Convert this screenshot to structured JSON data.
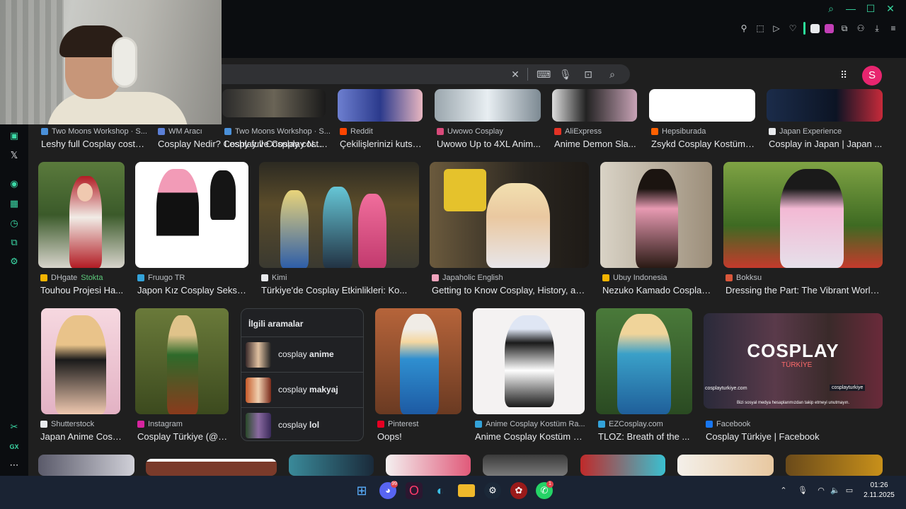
{
  "toolbar": {
    "icons": [
      "search-icon",
      "minimize-icon",
      "maximize-icon",
      "close-icon",
      "pin-icon",
      "screenshot-icon",
      "play-icon",
      "heart-icon",
      "extension-icon",
      "puzzle-icon",
      "account-icon",
      "download-icon",
      "menu-icon"
    ]
  },
  "search": {
    "avatar_letter": "S"
  },
  "rows": {
    "r1": [
      {
        "source": "Two Moons Workshop · S...",
        "title": "Leshy full Cosplay costu..."
      },
      {
        "source": "WM Aracı",
        "title": "Cosplay Nedir? Cosplay ve Cosplay Nası..."
      },
      {
        "source": "Reddit",
        "title": "Çekilişlerinizi kutsa..."
      },
      {
        "source": "Uwowo Cosplay",
        "title": "Uwowo Up to 4XL Anim..."
      },
      {
        "source": "AliExpress",
        "title": "Anime Demon Sla..."
      },
      {
        "source": "Hepsiburada",
        "title": "Zsykd Cosplay Kostüm ..."
      },
      {
        "source": "Japan Experience",
        "title": "Cosplay in Japan | Japan ..."
      }
    ],
    "r2": [
      {
        "source": "DHgate",
        "source_extra": "Stokta",
        "title": "Touhou Projesi Ha..."
      },
      {
        "source": "Fruugo TR",
        "title": "Japon Kız Cosplay Seksi ..."
      },
      {
        "source": "Kimi",
        "title": "Türkiye'de Cosplay Etkinlikleri: Ko..."
      },
      {
        "source": "Japaholic English",
        "title": "Getting to Know Cosplay, History, and ..."
      },
      {
        "source": "Ubuy Indonesia",
        "title": "Nezuko Kamado Cosplay ..."
      },
      {
        "source": "Bokksu",
        "title": "Dressing the Part: The Vibrant World ..."
      }
    ],
    "r3": [
      {
        "source": "Shutterstock",
        "title": "Japan Anime Cosp..."
      },
      {
        "source": "Instagram",
        "title": "Cosplay Türkiye (@c..."
      },
      {
        "source": "Pinterest",
        "title": "Oops!"
      },
      {
        "source": "Anime Cosplay Kostüm Ra...",
        "title": "Anime Cosplay Kostüm R..."
      },
      {
        "source": "EZCosplay.com",
        "title": "TLOZ: Breath of the ..."
      },
      {
        "source": "Facebook",
        "title": "Cosplay Türkiye | Facebook"
      }
    ]
  },
  "related": {
    "heading": "İlgili aramalar",
    "items": [
      {
        "prefix": "cosplay ",
        "bold": "anime"
      },
      {
        "prefix": "cosplay ",
        "bold": "makyaj"
      },
      {
        "prefix": "cosplay ",
        "bold": "lol"
      }
    ]
  },
  "banner": {
    "title": "COSPLAY",
    "subtitle": "TÜRKİYE",
    "site": "cosplayturkiye.com",
    "handle": "cosplayturkiye",
    "tagline": "Bizi sosyal medya hesaplarımızdan takip etmeyi unutmayın."
  },
  "taskbar": {
    "discord_badge": "99",
    "whatsapp_badge": "1",
    "time": "01:26",
    "date": "2.11.2025"
  },
  "colors": {
    "accent": "#38d6a0",
    "page_bg": "#1f1f1f",
    "taskbar": "#1a2333",
    "avatar": "#e8256f"
  }
}
